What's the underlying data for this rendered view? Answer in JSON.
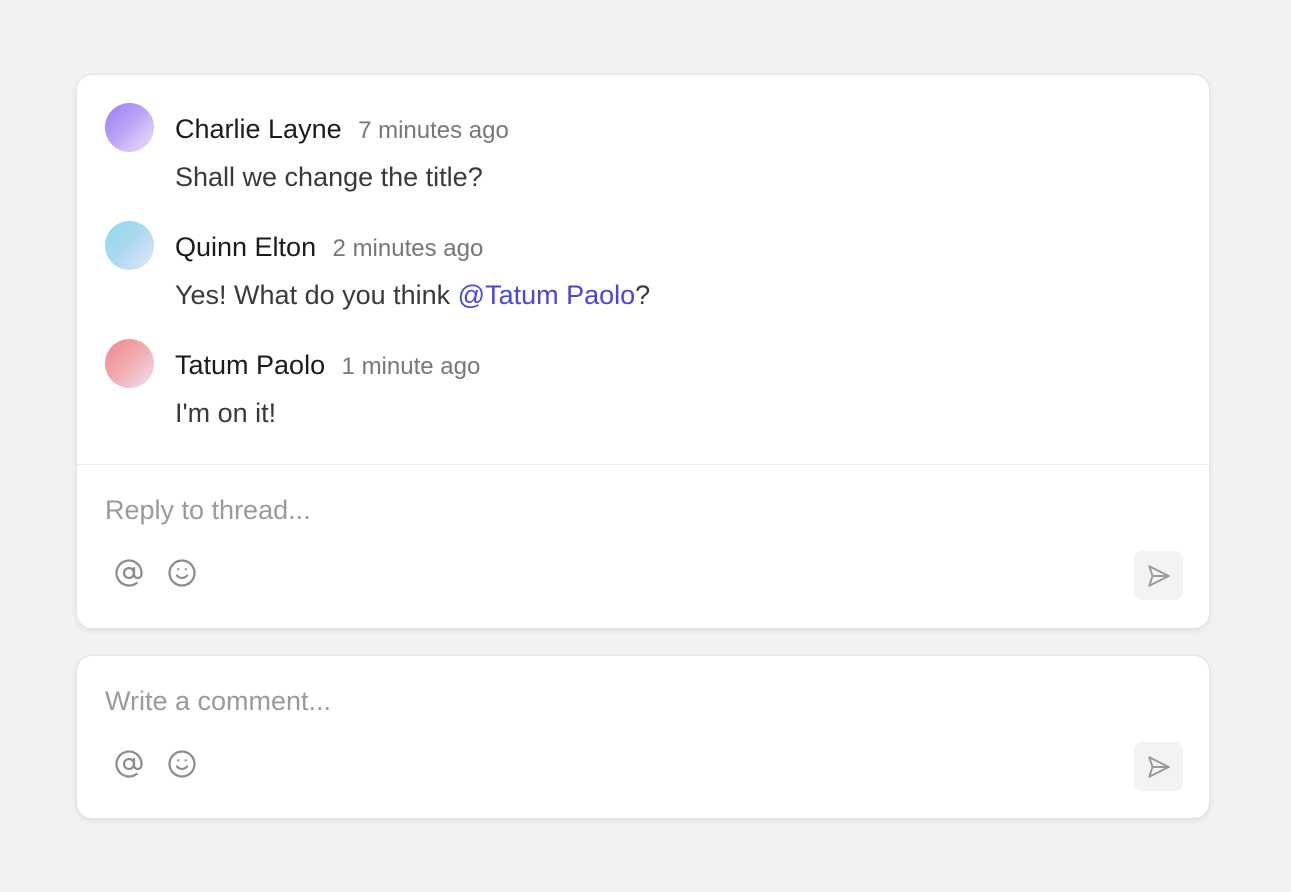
{
  "thread": {
    "comments": [
      {
        "author": "Charlie Layne",
        "time": "7 minutes ago",
        "text": "Shall we change the title?",
        "avatar_color": "#9b7cf0"
      },
      {
        "author": "Quinn Elton",
        "time": "2 minutes ago",
        "text_before": "Yes! What do you think ",
        "mention": "@Tatum Paolo",
        "text_after": "?",
        "avatar_color": "#8ad9ee"
      },
      {
        "author": "Tatum Paolo",
        "time": "1 minute ago",
        "text": "I'm on it!",
        "avatar_color": "#ee8a8a"
      }
    ],
    "reply": {
      "placeholder": "Reply to thread...",
      "value": ""
    }
  },
  "new_comment": {
    "placeholder": "Write a comment...",
    "value": ""
  },
  "icons": {
    "mention": "at-sign-icon",
    "emoji": "smiley-icon",
    "send": "send-icon"
  },
  "colors": {
    "mention_link": "#4a44e0",
    "background": "#f2f2f2"
  }
}
